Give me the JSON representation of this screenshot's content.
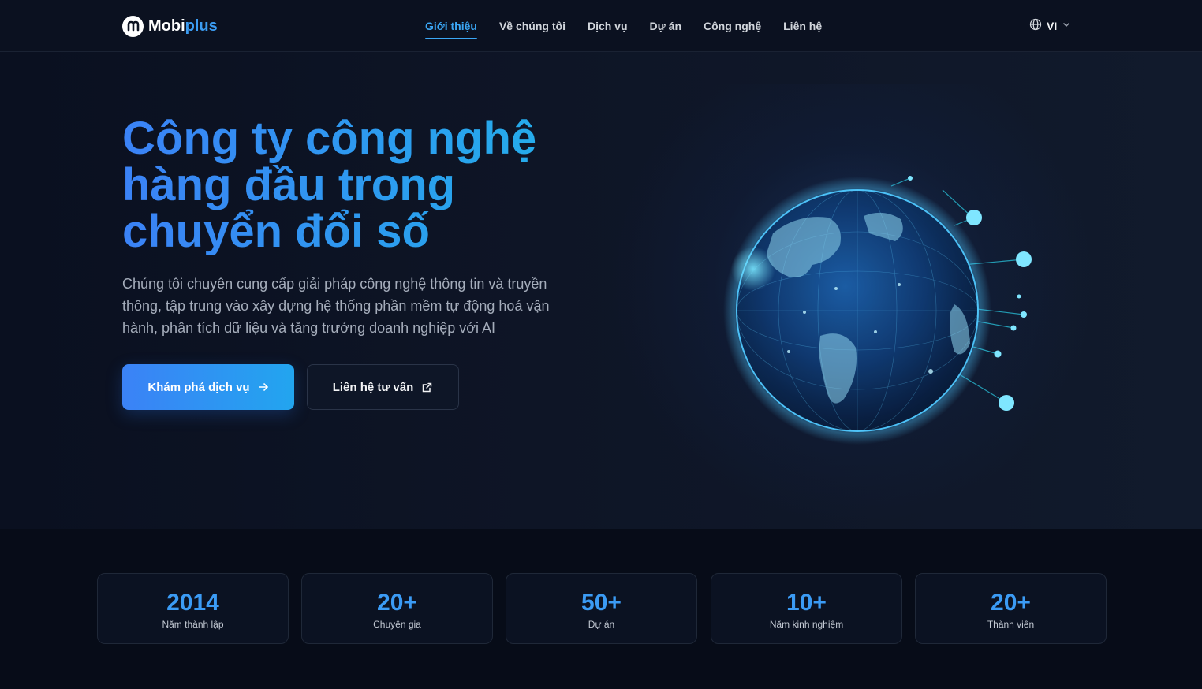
{
  "brand": {
    "name_part1": "Mobi",
    "name_part2": "plus",
    "colors": {
      "accent": "#3b9bf5",
      "background": "#0a0f1c"
    }
  },
  "nav": {
    "items": [
      {
        "label": "Giới thiệu",
        "active": true
      },
      {
        "label": "Về chúng tôi",
        "active": false
      },
      {
        "label": "Dịch vụ",
        "active": false
      },
      {
        "label": "Dự án",
        "active": false
      },
      {
        "label": "Công nghệ",
        "active": false
      },
      {
        "label": "Liên hệ",
        "active": false
      }
    ]
  },
  "language": {
    "label": "VI",
    "icon": "globe-icon"
  },
  "hero": {
    "title_lines": [
      "Công ty công nghệ",
      "hàng đầu trong",
      "chuyển đổi số"
    ],
    "description": "Chúng tôi chuyên cung cấp giải pháp công nghệ thông tin và truyền thông, tập trung vào xây dựng hệ thống phần mềm tự động hoá vận hành, phân tích dữ liệu và tăng trưởng doanh nghiệp với AI",
    "primary_button": "Khám phá dịch vụ",
    "secondary_button": "Liên hệ tư vấn"
  },
  "stats": [
    {
      "value": "2014",
      "label": "Năm thành lập"
    },
    {
      "value": "20+",
      "label": "Chuyên gia"
    },
    {
      "value": "50+",
      "label": "Dự án"
    },
    {
      "value": "10+",
      "label": "Năm kinh nghiệm"
    },
    {
      "value": "20+",
      "label": "Thành viên"
    }
  ]
}
